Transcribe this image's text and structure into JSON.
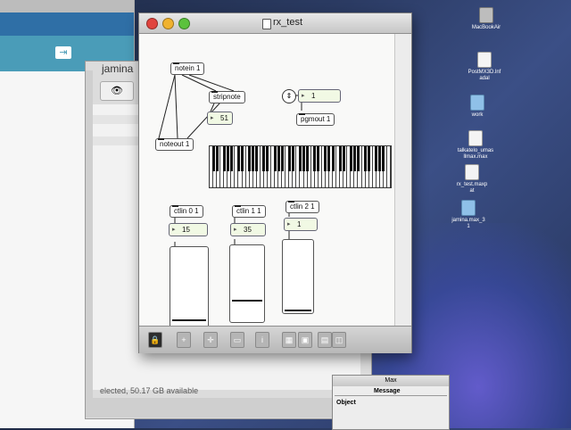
{
  "colors": {
    "desktop": "#2b3b63",
    "title_red": "#e0443e",
    "title_yellow": "#f0b22f",
    "title_green": "#5bc23c"
  },
  "desktop": {
    "icons": [
      {
        "label": "MacBookAir",
        "kind": "drive"
      },
      {
        "label": "PostMX3D.lnf\nadal",
        "kind": "doc"
      },
      {
        "label": "work",
        "kind": "folder"
      },
      {
        "label": "talkatelo_umas\nllmax.max",
        "kind": "doc"
      },
      {
        "label": "rx_test.maxp\nat",
        "kind": "doc"
      },
      {
        "label": "jamina.max_3\n1",
        "kind": "folder"
      }
    ]
  },
  "finder": {
    "share_icon": "share-icon"
  },
  "jamina_window": {
    "title": "jamina",
    "status": "elected, 50.17 GB available"
  },
  "patcher": {
    "title": "rx_test",
    "objects": {
      "notein": "notein 1",
      "stripnote": "stripnote",
      "noteout": "noteout 1",
      "pgmout": "pgmout 1",
      "ctlin0": "ctlin 0 1",
      "ctlin1": "ctlin 1 1",
      "ctlin2": "ctlin 2 1"
    },
    "numbers": {
      "pitch": "51",
      "program": "1",
      "ctl0": "15",
      "ctl1": "35",
      "ctl2": "1"
    },
    "sliders": [
      {
        "name": "ctlin-0-slider",
        "value": 15,
        "max": 127
      },
      {
        "name": "ctlin-1-slider",
        "value": 35,
        "max": 127
      },
      {
        "name": "ctlin-2-slider",
        "value": 1,
        "max": 127
      }
    ]
  },
  "console": {
    "title": "Max",
    "columns": [
      "Message",
      "Object"
    ]
  }
}
